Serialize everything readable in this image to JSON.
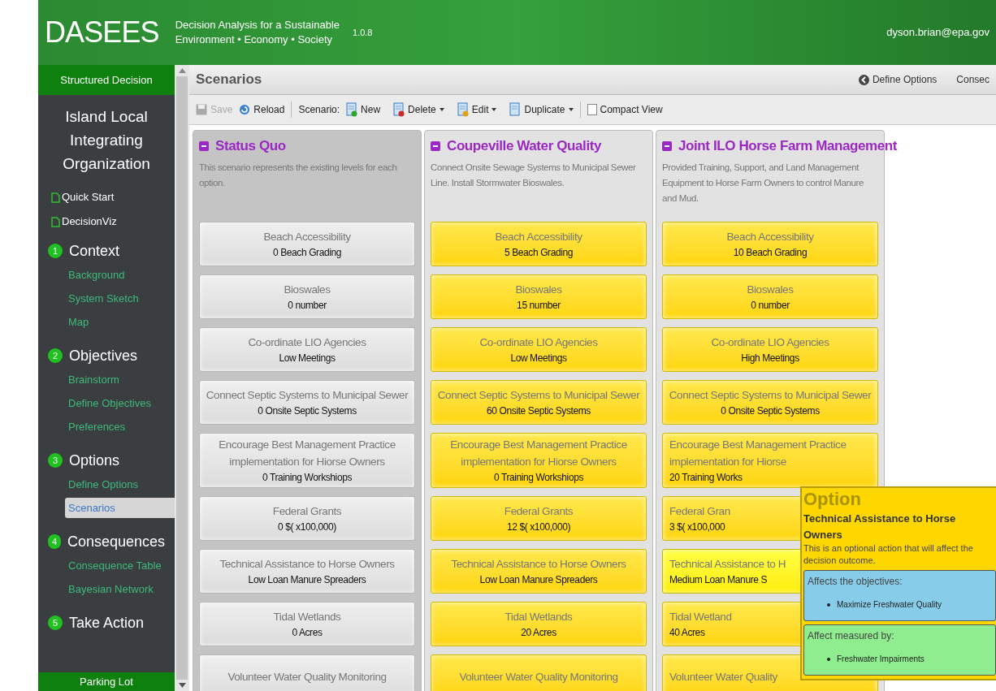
{
  "header": {
    "logo": "DASEES",
    "tagline_1": "Decision Analysis for a Sustainable",
    "tagline_2": "Environment • Economy • Society",
    "version": "1.0.8",
    "user": "dyson.brian@epa.gov"
  },
  "sidebar": {
    "top_bar": "Structured Decision",
    "organization": "Island Local Integrating Organization",
    "links": [
      {
        "label": "Quick Start"
      },
      {
        "label": "DecisionViz"
      }
    ],
    "sections": [
      {
        "number": "1",
        "title": "Context",
        "items": [
          {
            "label": "Background",
            "selected": false
          },
          {
            "label": "System Sketch",
            "selected": false
          },
          {
            "label": "Map",
            "selected": false
          }
        ]
      },
      {
        "number": "2",
        "title": "Objectives",
        "items": [
          {
            "label": "Brainstorm",
            "selected": false
          },
          {
            "label": "Define Objectives",
            "selected": false
          },
          {
            "label": "Preferences",
            "selected": false
          }
        ]
      },
      {
        "number": "3",
        "title": "Options",
        "items": [
          {
            "label": "Define Options",
            "selected": false
          },
          {
            "label": "Scenarios",
            "selected": true
          }
        ]
      },
      {
        "number": "4",
        "title": "Consequences",
        "items": [
          {
            "label": "Consequence Table",
            "selected": false
          },
          {
            "label": "Bayesian Network",
            "selected": false
          }
        ]
      },
      {
        "number": "5",
        "title": "Take Action"
      }
    ],
    "bottom_bar": "Parking Lot"
  },
  "page": {
    "title": "Scenarios",
    "nav": [
      "Define Options",
      "Consec"
    ]
  },
  "toolbar": {
    "save": {
      "label": "Save",
      "disabled": true
    },
    "reload": "Reload",
    "scenario_label": "Scenario:",
    "new": "New",
    "delete": "Delete",
    "edit": "Edit",
    "duplicate": "Duplicate",
    "compact_view": {
      "label": "Compact View",
      "checked": false
    }
  },
  "scenarios": [
    {
      "kind": "status_quo",
      "title": "Status Quo",
      "description": "This scenario represents the existing levels for each option.",
      "options": [
        {
          "name": "Beach Accessibility",
          "value": "0 Beach Grading",
          "hovered": false,
          "covered": false
        },
        {
          "name": "Bioswales",
          "value": "0 number",
          "hovered": false,
          "covered": false
        },
        {
          "name": "Co-ordinate LIO Agencies",
          "value": "Low Meetings",
          "hovered": false,
          "covered": false
        },
        {
          "name": "Connect Septic Systems to Municipal Sewer",
          "value": "0 Onsite Septic Systems",
          "hovered": false,
          "covered": false
        },
        {
          "name": "Encourage Best Management Practice implementation for Hiorse Owners",
          "value": "0 Training Workshiops",
          "hovered": false,
          "covered": false
        },
        {
          "name": "Federal Grants",
          "value": "0 $( x100,000)",
          "hovered": false,
          "covered": false
        },
        {
          "name": "Technical Assistance to Horse Owners",
          "value": "Low Loan Manure Spreaders",
          "hovered": false,
          "covered": false
        },
        {
          "name": "Tidal Wetlands",
          "value": "0 Acres",
          "hovered": false,
          "covered": false
        },
        {
          "name": "Volunteer Water Quality Monitoring",
          "hovered": false,
          "covered": false
        }
      ]
    },
    {
      "kind": "alternative",
      "title": "Coupeville Water Quality",
      "description": "Connect Onsite Sewage Systems to Municipal Sewer Line. Install Stormwater Bioswales.",
      "options": [
        {
          "name": "Beach Accessibility",
          "value": "5 Beach Grading",
          "hovered": false,
          "covered": false
        },
        {
          "name": "Bioswales",
          "value": "15 number",
          "hovered": false,
          "covered": false
        },
        {
          "name": "Co-ordinate LIO Agencies",
          "value": "Low Meetings",
          "hovered": false,
          "covered": false
        },
        {
          "name": "Connect Septic Systems to Municipal Sewer",
          "value": "60 Onsite Septic Systems",
          "hovered": false,
          "covered": false
        },
        {
          "name": "Encourage Best Management Practice implementation for Hiorse Owners",
          "value": "0 Training Workshiops",
          "hovered": false,
          "covered": false
        },
        {
          "name": "Federal Grants",
          "value": "12 $( x100,000)",
          "hovered": false,
          "covered": false
        },
        {
          "name": "Technical Assistance to Horse Owners",
          "value": "Low Loan Manure Spreaders",
          "hovered": false,
          "covered": false
        },
        {
          "name": "Tidal Wetlands",
          "value": "20 Acres",
          "hovered": false,
          "covered": false
        },
        {
          "name": "Volunteer Water Quality Monitoring",
          "hovered": false,
          "covered": false
        }
      ]
    },
    {
      "kind": "alternative",
      "title": "Joint ILO Horse Farm Management",
      "description": "Provided Training, Support, and Land Management Equipment to Horse Farm Owners to control Manure and Mud.",
      "options": [
        {
          "name": "Beach Accessibility",
          "value": "10 Beach Grading",
          "hovered": false,
          "covered": false
        },
        {
          "name": "Bioswales",
          "value": "0 number",
          "hovered": false,
          "covered": false
        },
        {
          "name": "Co-ordinate LIO Agencies",
          "value": "High Meetings",
          "hovered": false,
          "covered": false
        },
        {
          "name": "Connect Septic Systems to Municipal Sewer",
          "value": "0 Onsite Septic Systems",
          "hovered": false,
          "covered": false
        },
        {
          "name": "Encourage Best Management Practice implementation for Hiorse",
          "value": "20 Training Works",
          "hovered": false,
          "covered": true
        },
        {
          "name": "Federal Gran",
          "value": "3 $( x100,000",
          "hovered": false,
          "covered": true
        },
        {
          "name": "Technical Assistance to H",
          "value": "Medium Loan Manure S",
          "hovered": true,
          "covered": true
        },
        {
          "name": "Tidal Wetland",
          "value": "40 Acres",
          "hovered": false,
          "covered": true
        },
        {
          "name": "Volunteer Water Quality",
          "hovered": false,
          "covered": true
        }
      ]
    }
  ],
  "tooltip": {
    "heading": "Option",
    "name": "Technical Assistance to Horse Owners",
    "description": "This is an optional action that will affect the decision outcome.",
    "objectives": {
      "title": "Affects the objectives:",
      "items": [
        "Maximize Freshwater Quality"
      ]
    },
    "measures": {
      "title": "Affect measured by:",
      "items": [
        "Freshwater Impairments"
      ]
    }
  }
}
